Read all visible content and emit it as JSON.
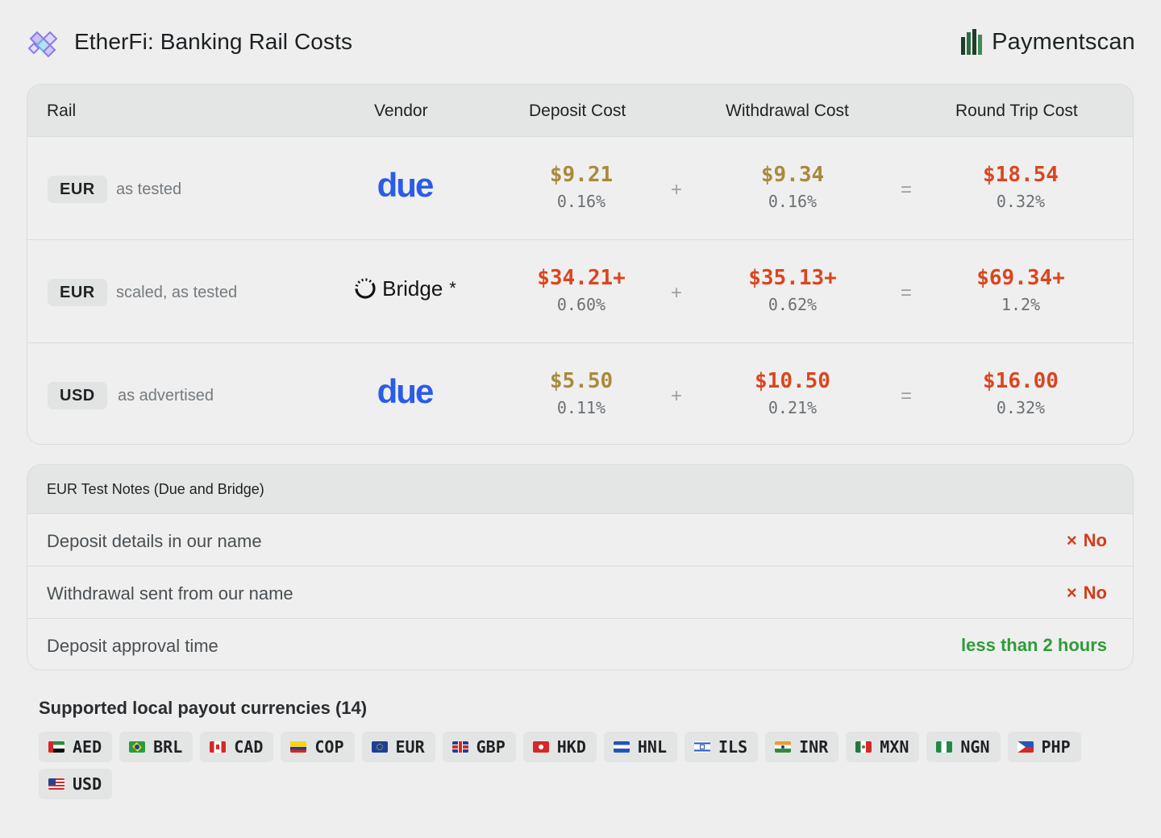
{
  "header": {
    "title": "EtherFi: Banking Rail Costs",
    "brand": "Paymentscan"
  },
  "costs": {
    "columns": {
      "rail": "Rail",
      "vendor": "Vendor",
      "deposit": "Deposit Cost",
      "withdrawal": "Withdrawal Cost",
      "roundtrip": "Round Trip Cost"
    },
    "operators": {
      "plus": "+",
      "equals": "="
    },
    "rows": [
      {
        "currency": "EUR",
        "note": "as tested",
        "vendor": "due",
        "vendor_logo": "due-logo",
        "deposit": "$9.21",
        "deposit_pct": "0.16%",
        "withdrawal": "$9.34",
        "withdrawal_pct": "0.16%",
        "roundtrip": "$18.54",
        "roundtrip_pct": "0.32%"
      },
      {
        "currency": "EUR",
        "note": "scaled, as tested",
        "vendor": "Bridge",
        "vendor_mark": "*",
        "vendor_logo": "bridge-logo",
        "deposit": "$34.21+",
        "deposit_pct": "0.60%",
        "withdrawal": "$35.13+",
        "withdrawal_pct": "0.62%",
        "roundtrip": "$69.34+",
        "roundtrip_pct": "1.2%"
      },
      {
        "currency": "USD",
        "note": "as advertised",
        "vendor": "due",
        "vendor_logo": "due-logo",
        "deposit": "$5.50",
        "deposit_pct": "0.11%",
        "withdrawal": "$10.50",
        "withdrawal_pct": "0.21%",
        "roundtrip": "$16.00",
        "roundtrip_pct": "0.32%"
      }
    ],
    "colors": {
      "amber": "#a88a3a",
      "red": "#d9461f"
    }
  },
  "notes": {
    "title": "EUR Test Notes (Due and Bridge)",
    "rows": [
      {
        "label": "Deposit details in our name",
        "icon": "x-icon",
        "mark": "×",
        "value": "No"
      },
      {
        "label": "Withdrawal sent from our name",
        "icon": "x-icon",
        "mark": "×",
        "value": "No"
      },
      {
        "label": "Deposit approval time",
        "value": "less than 2 hours"
      }
    ],
    "colors": {
      "no": "#d43b1a",
      "ok": "#2e9c36"
    }
  },
  "currencies": {
    "title": "Supported local payout currencies (14)",
    "items": [
      "AED",
      "BRL",
      "CAD",
      "COP",
      "EUR",
      "GBP",
      "HKD",
      "HNL",
      "ILS",
      "INR",
      "MXN",
      "NGN",
      "PHP",
      "USD"
    ]
  }
}
